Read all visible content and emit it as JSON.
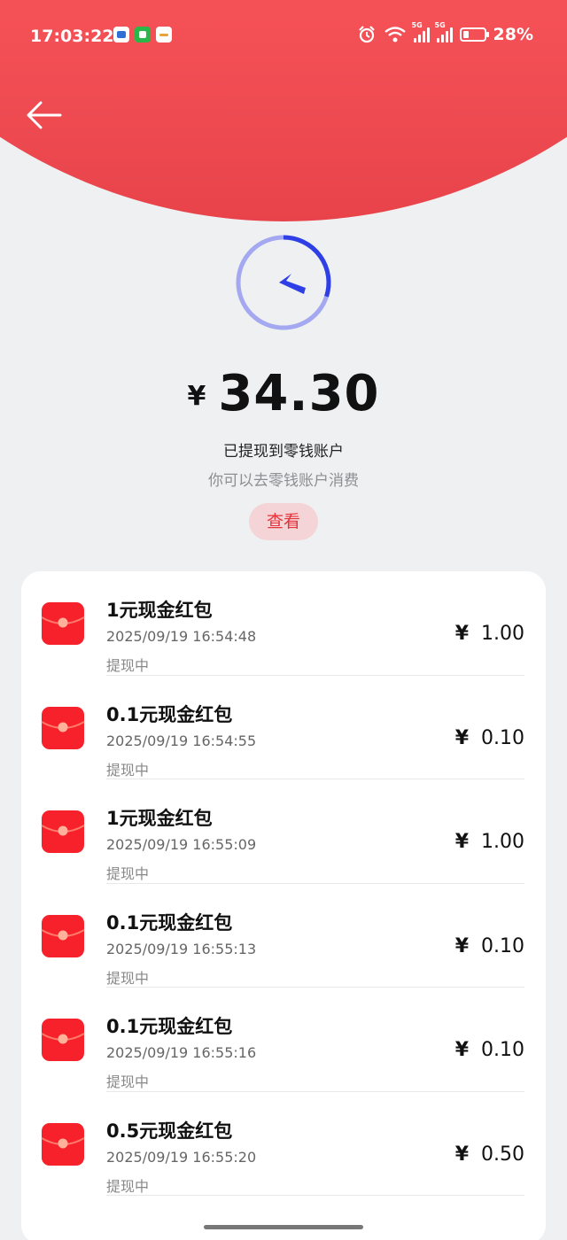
{
  "status_bar": {
    "time": "17:03:22",
    "battery": "28%",
    "network_label": "5G",
    "battery_level_percent": 28,
    "apps": [
      {
        "icon": "app-blue-icon",
        "color": "#2f6fd6"
      },
      {
        "icon": "app-green-icon",
        "color": "#2bb64a"
      },
      {
        "icon": "app-realme-icon",
        "color": "#e8a33a"
      }
    ]
  },
  "summary": {
    "currency": "¥",
    "amount": "34.30",
    "message": "已提现到零钱账户",
    "hint": "你可以去零钱账户消费",
    "view_label": "查看",
    "progress_fraction": 0.3
  },
  "records": [
    {
      "title": "1元现金红包",
      "time": "2025/09/19 16:54:48",
      "status": "提现中",
      "currency": "¥",
      "amount": "1.00"
    },
    {
      "title": "0.1元现金红包",
      "time": "2025/09/19 16:54:55",
      "status": "提现中",
      "currency": "¥",
      "amount": "0.10"
    },
    {
      "title": "1元现金红包",
      "time": "2025/09/19 16:55:09",
      "status": "提现中",
      "currency": "¥",
      "amount": "1.00"
    },
    {
      "title": "0.1元现金红包",
      "time": "2025/09/19 16:55:13",
      "status": "提现中",
      "currency": "¥",
      "amount": "0.10"
    },
    {
      "title": "0.1元现金红包",
      "time": "2025/09/19 16:55:16",
      "status": "提现中",
      "currency": "¥",
      "amount": "0.10"
    },
    {
      "title": "0.5元现金红包",
      "time": "2025/09/19 16:55:20",
      "status": "提现中",
      "currency": "¥",
      "amount": "0.50"
    }
  ],
  "colors": {
    "header_red": "#f45157",
    "accent_red": "#e5333b",
    "timer_blue": "#2f3fe6",
    "timer_ring": "#a3a8f0"
  }
}
